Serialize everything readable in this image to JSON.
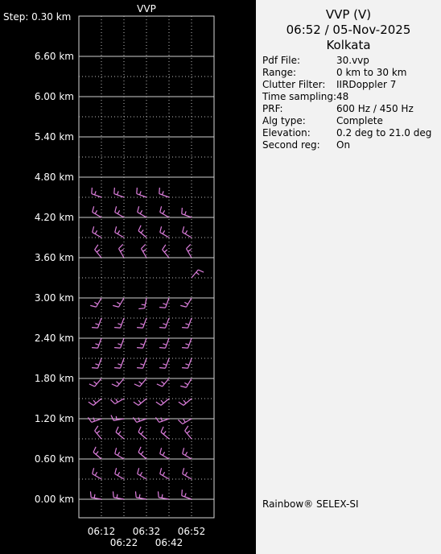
{
  "chart_data": {
    "type": "wind-barb-profile",
    "title": "VVP",
    "y_step_label": "Step: 0.30 km",
    "y_ticks": [
      "0.00 km",
      "0.60 km",
      "1.20 km",
      "1.80 km",
      "2.40 km",
      "3.00 km",
      "3.60 km",
      "4.20 km",
      "4.80 km",
      "5.40 km",
      "6.00 km",
      "6.60 km"
    ],
    "y_tick_values": [
      0.0,
      0.6,
      1.2,
      1.8,
      2.4,
      3.0,
      3.6,
      4.2,
      4.8,
      5.4,
      6.0,
      6.6
    ],
    "ylim": [
      0.0,
      6.9
    ],
    "x_ticks_top": [
      "06:12",
      "06:32",
      "06:52"
    ],
    "x_ticks_bottom": [
      "06:22",
      "06:42"
    ],
    "times": [
      "06:12",
      "06:22",
      "06:32",
      "06:42",
      "06:52"
    ],
    "barb_color": "#e080e0",
    "grid": true,
    "profiles": [
      {
        "time": "06:12",
        "heights": [
          0.0,
          0.3,
          0.6,
          0.9,
          1.2,
          1.5,
          1.8,
          2.1,
          2.4,
          2.7,
          3.0,
          3.6,
          3.9,
          4.2,
          4.5
        ],
        "directions": [
          280,
          300,
          310,
          320,
          250,
          230,
          220,
          200,
          200,
          200,
          210,
          320,
          300,
          300,
          290
        ]
      },
      {
        "time": "06:22",
        "heights": [
          0.0,
          0.3,
          0.6,
          0.9,
          1.2,
          1.5,
          1.8,
          2.1,
          2.4,
          2.7,
          3.0,
          3.6,
          3.9,
          4.2,
          4.5
        ],
        "directions": [
          280,
          300,
          300,
          310,
          260,
          240,
          220,
          200,
          200,
          200,
          210,
          330,
          300,
          300,
          290
        ]
      },
      {
        "time": "06:32",
        "heights": [
          0.0,
          0.3,
          0.6,
          0.9,
          1.2,
          1.5,
          1.8,
          2.1,
          2.4,
          2.7,
          3.0,
          3.6,
          3.9,
          4.2,
          4.5
        ],
        "directions": [
          280,
          300,
          310,
          310,
          250,
          230,
          220,
          200,
          200,
          200,
          190,
          330,
          310,
          300,
          290
        ]
      },
      {
        "time": "06:42",
        "heights": [
          0.0,
          0.3,
          0.6,
          0.9,
          1.2,
          1.5,
          1.8,
          2.1,
          2.4,
          2.7,
          3.0,
          3.6,
          3.9,
          4.2,
          4.5
        ],
        "directions": [
          280,
          300,
          300,
          310,
          250,
          230,
          220,
          200,
          200,
          200,
          200,
          320,
          300,
          300,
          290
        ]
      },
      {
        "time": "06:52",
        "heights": [
          0.0,
          0.3,
          0.6,
          0.9,
          1.2,
          1.5,
          1.8,
          2.1,
          2.4,
          2.7,
          3.0,
          3.3,
          3.6,
          3.9,
          4.2
        ],
        "directions": [
          290,
          300,
          300,
          320,
          240,
          230,
          210,
          200,
          200,
          200,
          210,
          40,
          330,
          300,
          290
        ]
      }
    ]
  },
  "panel": {
    "title": "VVP (V)",
    "datetime": "06:52 / 05-Nov-2025",
    "location": "Kolkata",
    "info": [
      {
        "key": "Pdf File:",
        "value": "30.vvp"
      },
      {
        "key": "Range:",
        "value": "0 km to 30 km"
      },
      {
        "key": "Clutter Filter:",
        "value": "IIRDoppler 7"
      },
      {
        "key": "Time sampling:",
        "value": "48"
      },
      {
        "key": "PRF:",
        "value": "600 Hz / 450 Hz"
      },
      {
        "key": "Alg type:",
        "value": "Complete"
      },
      {
        "key": "Elevation:",
        "value": "0.2 deg to 21.0 deg"
      },
      {
        "key": "Second reg:",
        "value": "On"
      }
    ],
    "brand": "Rainbow® SELEX-SI"
  }
}
